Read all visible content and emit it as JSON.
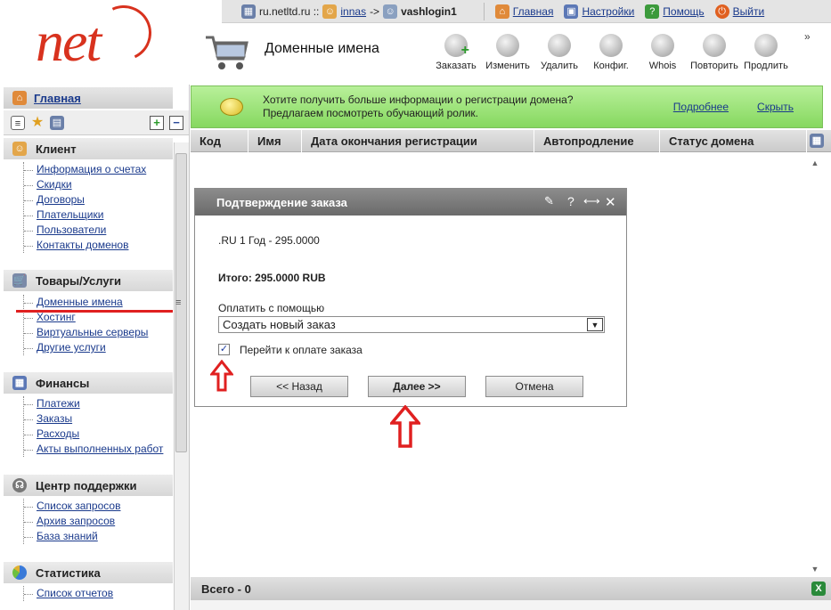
{
  "topbar": {
    "host": "ru.netltd.ru ::",
    "user": "innas",
    "arrow": "->",
    "login": "vashlogin1",
    "home": "Главная",
    "settings": "Настройки",
    "help": "Помощь",
    "logout": "Выйти"
  },
  "header": {
    "title": "Доменные имена",
    "more": "»"
  },
  "tools": [
    {
      "label": "Заказать"
    },
    {
      "label": "Изменить"
    },
    {
      "label": "Удалить"
    },
    {
      "label": "Конфиг."
    },
    {
      "label": "Whois"
    },
    {
      "label": "Повторить"
    },
    {
      "label": "Продлить"
    }
  ],
  "sidebar": {
    "home": "Главная",
    "sections": [
      {
        "title": "Клиент",
        "items": [
          "Информация о счетах",
          "Скидки",
          "Договоры",
          "Плательщики",
          "Пользователи",
          "Контакты доменов"
        ]
      },
      {
        "title": "Товары/Услуги",
        "items": [
          "Доменные имена",
          "Хостинг",
          "Виртуальные серверы",
          "Другие услуги"
        ]
      },
      {
        "title": "Финансы",
        "items": [
          "Платежи",
          "Заказы",
          "Расходы",
          "Акты выполненных работ"
        ]
      },
      {
        "title": "Центр поддержки",
        "items": [
          "Список запросов",
          "Архив запросов",
          "База знаний"
        ]
      },
      {
        "title": "Статистика",
        "items": [
          "Список отчетов"
        ]
      }
    ]
  },
  "banner": {
    "line1": "Хотите получить больше информации о регистрации домена?",
    "line2": "Предлагаем посмотреть обучающий ролик.",
    "more": "Подробнее",
    "hide": "Скрыть"
  },
  "grid": {
    "columns": [
      "Код",
      "Имя",
      "Дата окончания регистрации",
      "Автопродление",
      "Статус домена"
    ],
    "total": "Всего - 0"
  },
  "dialog": {
    "title": "Подтверждение заказа",
    "line": ".RU 1 Год - 295.0000",
    "total": "Итого: 295.0000 RUB",
    "pay_label": "Оплатить с помощью",
    "pay_value": "Создать новый заказ",
    "checkbox_label": "Перейти к оплате заказа",
    "checkbox_checked": true,
    "back": "<< Назад",
    "next": "Далее >>",
    "cancel": "Отмена",
    "help": "?"
  },
  "colors": {
    "accent_red": "#d8321e",
    "banner_green": "#96e06e",
    "arrow_red": "#e02020"
  }
}
